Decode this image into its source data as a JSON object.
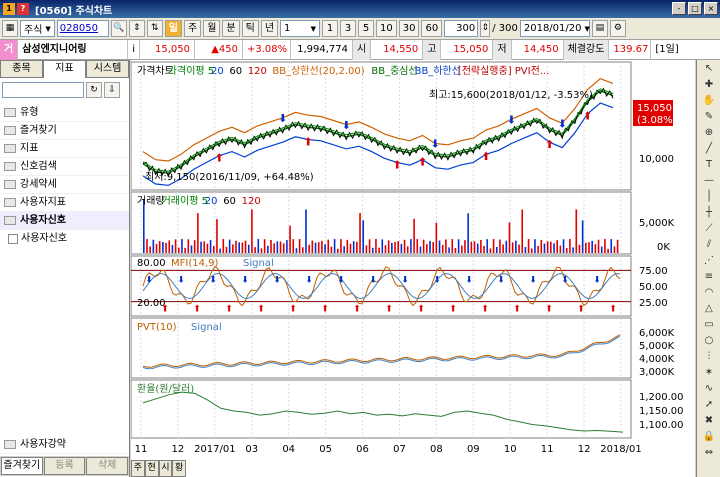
{
  "window": {
    "title": "[0560] 주식차트",
    "icon_a": "1",
    "icon_b": "?",
    "buttons": [
      "-",
      "□",
      "×"
    ]
  },
  "toolbar": {
    "market": "주식",
    "code": "028050",
    "period_on": "일",
    "periods": [
      "주",
      "월",
      "분",
      "틱",
      "년"
    ],
    "interval": "1",
    "quick": [
      "1",
      "3",
      "5",
      "10",
      "30",
      "60"
    ],
    "count": "300",
    "count_total": "/ 300",
    "date": "2018/01/20"
  },
  "info": {
    "badge": "거",
    "name": "삼성엔지니어링",
    "i_label": "i",
    "price": "15,050",
    "change": "▲450",
    "rate": "+3.08%",
    "volume": "1,994,774",
    "open_label": "시",
    "open": "14,550",
    "high_label": "고",
    "high": "15,050",
    "low_label": "저",
    "low": "14,450",
    "strength_label": "체결강도",
    "strength": "139.67",
    "period_tag": "[1일]"
  },
  "left": {
    "tabs": [
      "종목",
      "지표",
      "시스템"
    ],
    "active_tab": 1,
    "tree": [
      "유형",
      "즐겨찾기",
      "지표",
      "신호검색",
      "강세약세",
      "사용자지표",
      "사용자신호"
    ],
    "sub": "사용자신호",
    "bottom_node": "사용자강약",
    "bottom_tabs": [
      "즐겨찾기",
      "등록",
      "삭제"
    ]
  },
  "bottom_small_tabs": [
    "주",
    "현",
    "시",
    "황"
  ],
  "chart_data": [
    {
      "type": "line",
      "panel": "price",
      "legend": [
        "가격차트",
        "가격이평 5",
        "20",
        "60",
        "120",
        "BB_상한선(20,2.00)",
        "BB_중심선",
        "BB_하한선",
        "[전략실행중] PVI전..."
      ],
      "title": "",
      "annotations": [
        "최고:15,600(2018/01/12, -3.53%)",
        "최저:9,150(2016/11/09, +64.48%)"
      ],
      "last_label": "15,050",
      "last_rate": "(3.08%)",
      "y_ticks": [
        "10,000"
      ],
      "ylim": [
        8500,
        16500
      ],
      "x_labels": [
        "11",
        "12",
        "2017/01",
        "03",
        "04",
        "05",
        "06",
        "07",
        "08",
        "09",
        "10",
        "11",
        "12",
        "2018/01"
      ],
      "values": [
        10.0,
        9.4,
        9.3,
        9.8,
        10.5,
        11.0,
        11.5,
        11.8,
        11.4,
        11.9,
        12.2,
        12.5,
        12.9,
        12.7,
        12.6,
        12.3,
        12.0,
        12.2,
        11.8,
        11.3,
        11.0,
        10.8,
        11.2,
        10.6,
        10.5,
        10.8,
        11.0,
        11.6,
        11.9,
        12.4,
        12.8,
        13.2,
        12.5,
        12.1,
        13.2,
        14.6,
        15.4,
        15.05
      ]
    },
    {
      "type": "bar",
      "panel": "volume",
      "legend": [
        "거래량",
        "거래이평 5",
        "20",
        "60",
        "120"
      ],
      "y_ticks": [
        "5,000K",
        "0K"
      ]
    },
    {
      "type": "line",
      "panel": "mfi",
      "legend": [
        "MFI(14,9)",
        "Signal"
      ],
      "ref_lines": [
        "80.00",
        "20.00"
      ],
      "y_ticks": [
        "75.00",
        "50.00",
        "25.00"
      ],
      "ylim": [
        0,
        100
      ]
    },
    {
      "type": "line",
      "panel": "pvt",
      "legend": [
        "PVT(10)",
        "Signal"
      ],
      "y_ticks": [
        "6,000K",
        "5,000K",
        "4,000K",
        "3,000K"
      ]
    },
    {
      "type": "line",
      "panel": "fx",
      "legend": [
        "환율(원/달러)"
      ],
      "y_ticks": [
        "1,200.00",
        "1,150.00",
        "1,100.00"
      ],
      "values": [
        1170,
        1185,
        1200,
        1210,
        1205,
        1180,
        1150,
        1140,
        1135,
        1125,
        1130,
        1140,
        1135,
        1128,
        1132,
        1140,
        1130,
        1135,
        1125,
        1128,
        1122,
        1130,
        1125,
        1120,
        1135,
        1140,
        1132,
        1125,
        1110,
        1100,
        1090,
        1085,
        1078,
        1070,
        1066,
        1068,
        1065,
        1062
      ]
    }
  ],
  "colors": {
    "price": "#000000",
    "ma5": "#008000",
    "bb_upper": "#d06000",
    "bb_mid": "#007000",
    "bb_lower": "#0040d0",
    "up_bar": "#e00000",
    "down_bar": "#0030d0",
    "fx": "#2e7d32"
  }
}
